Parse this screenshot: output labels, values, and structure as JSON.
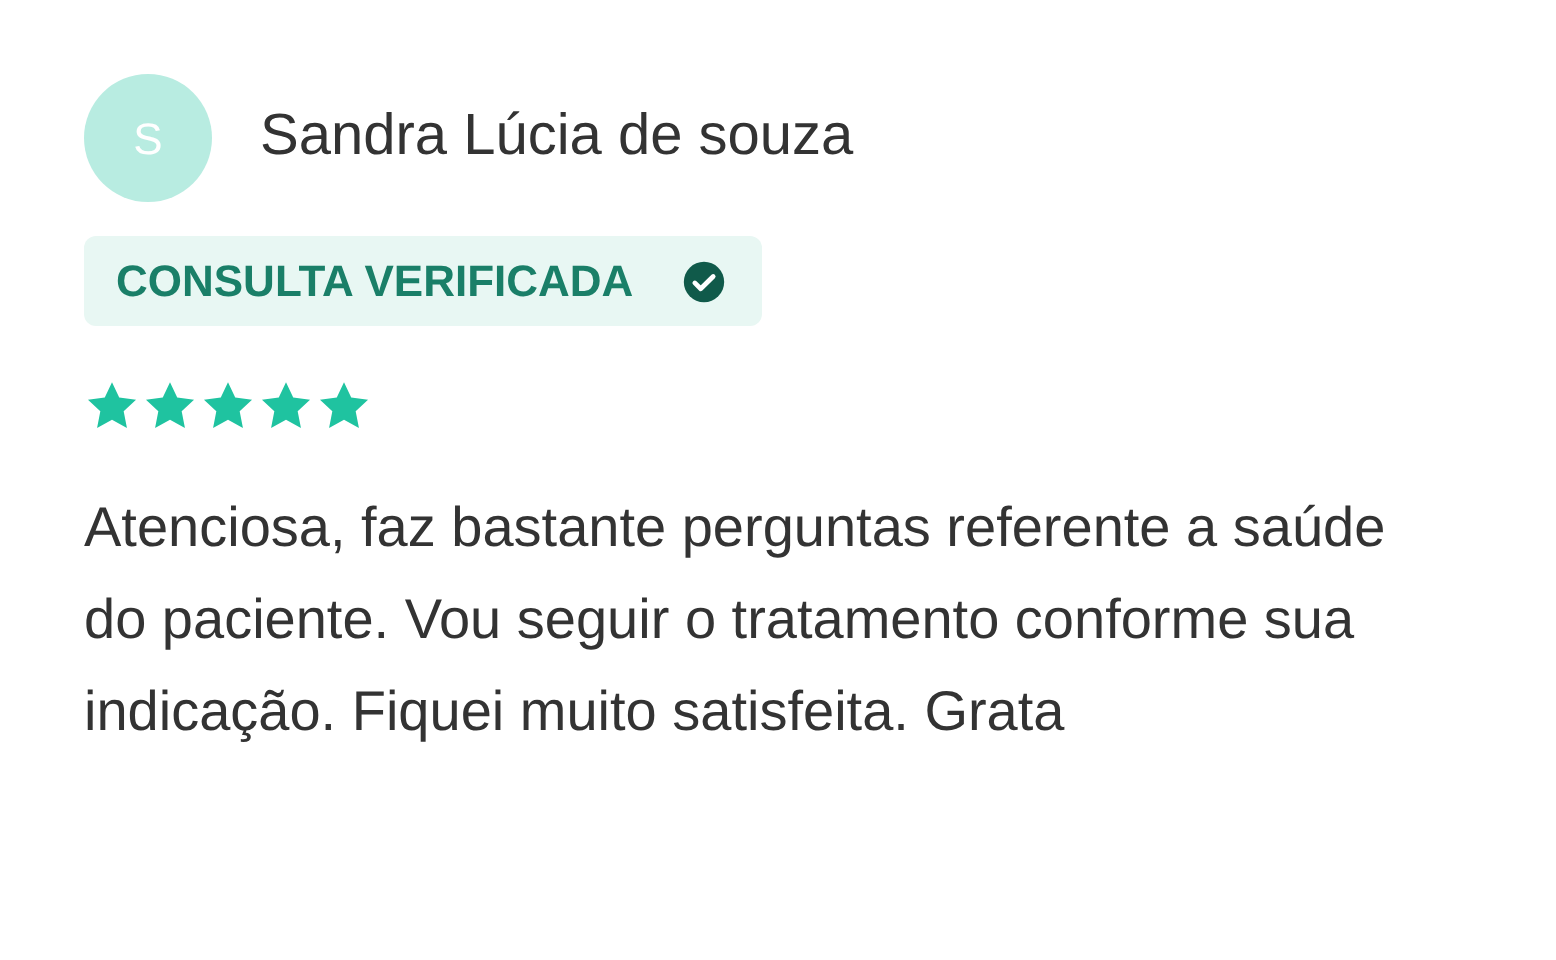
{
  "review": {
    "avatar_letter": "S",
    "author": "Sandra Lúcia de souza",
    "badge": {
      "label": "CONSULTA VERIFICADA",
      "verified": true
    },
    "stars": 5,
    "text": "Atenciosa, faz bastante perguntas referente a saúde do paciente. Vou seguir o tratamento conforme sua indicação. Fiquei muito satisfeita. Grata"
  }
}
